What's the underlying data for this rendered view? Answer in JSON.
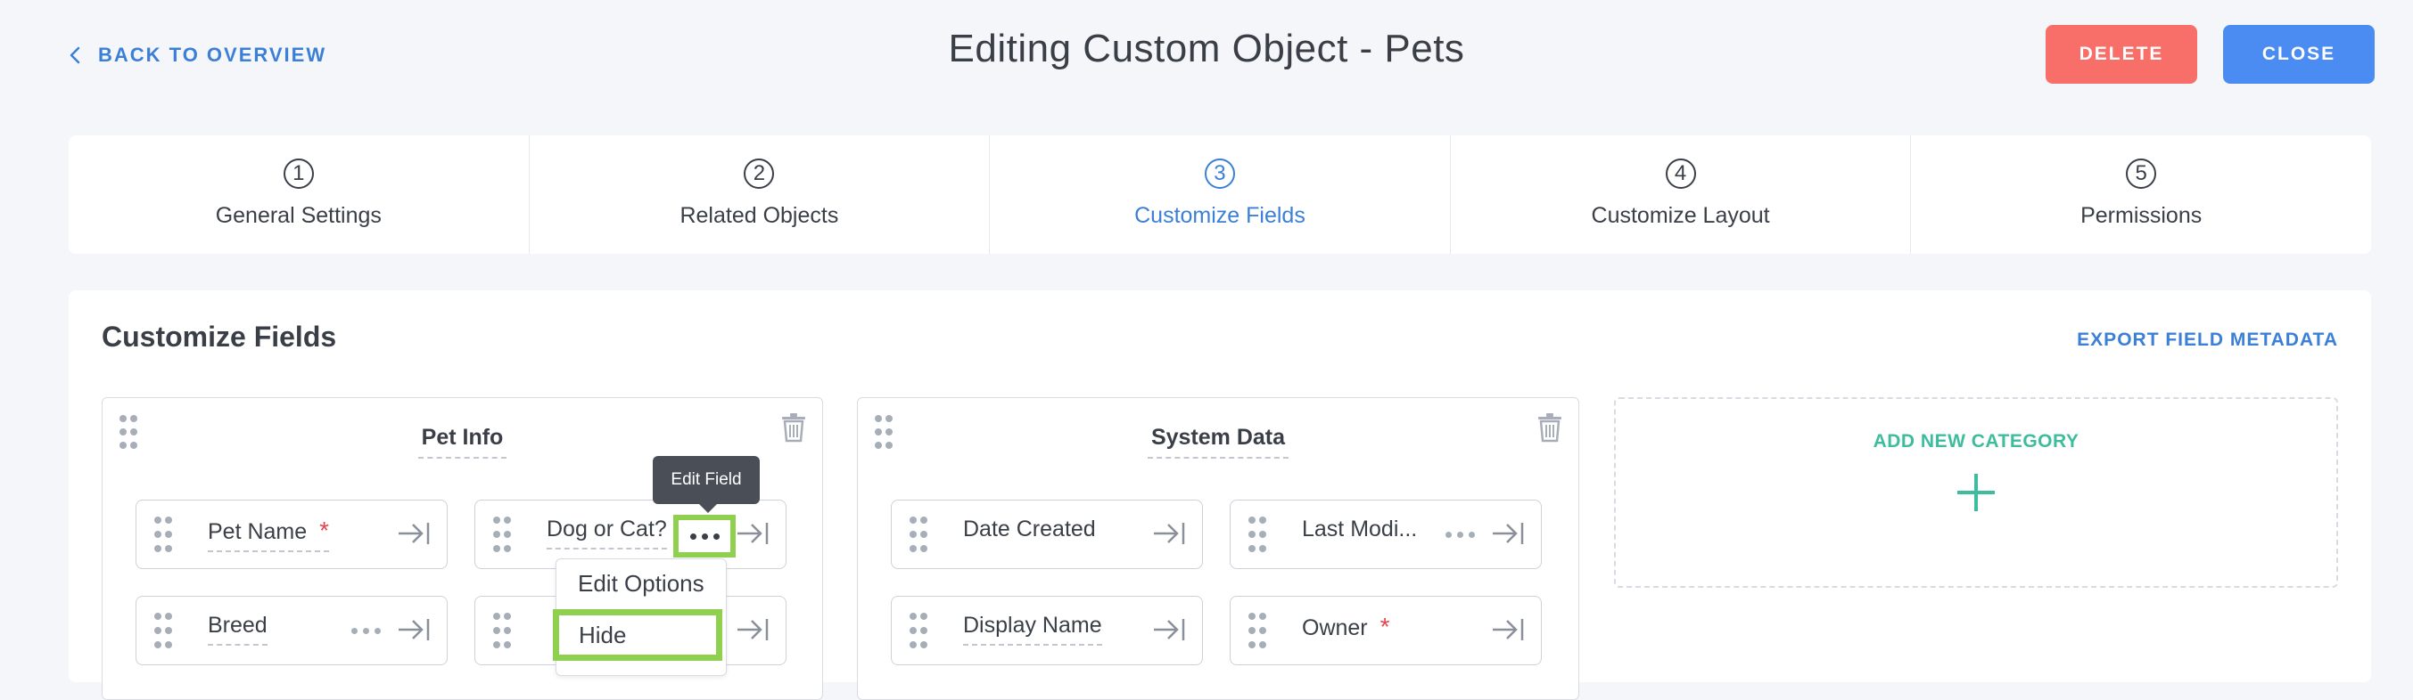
{
  "header": {
    "back_label": "BACK TO OVERVIEW",
    "title": "Editing Custom Object - Pets",
    "delete_label": "DELETE",
    "close_label": "CLOSE"
  },
  "steps": [
    {
      "num": "1",
      "label": "General Settings"
    },
    {
      "num": "2",
      "label": "Related Objects"
    },
    {
      "num": "3",
      "label": "Customize Fields",
      "active": true
    },
    {
      "num": "4",
      "label": "Customize Layout"
    },
    {
      "num": "5",
      "label": "Permissions"
    }
  ],
  "panel": {
    "title": "Customize Fields",
    "export_label": "EXPORT FIELD METADATA"
  },
  "categories": {
    "pet_info": {
      "title": "Pet Info",
      "fields": [
        {
          "label": "Pet Name",
          "required": "*"
        },
        {
          "label": "Dog or Cat?"
        },
        {
          "label": "Breed"
        }
      ]
    },
    "system_data": {
      "title": "System Data",
      "fields": [
        {
          "label": "Date Created"
        },
        {
          "label": "Last Modi..."
        },
        {
          "label": "Display Name"
        },
        {
          "label": "Owner",
          "required": "*"
        }
      ]
    },
    "add_new_label": "ADD NEW CATEGORY"
  },
  "tooltip": {
    "label": "Edit Field"
  },
  "context_menu": {
    "edit_options": "Edit Options",
    "hide": "Hide"
  },
  "colors": {
    "accent": "#3b7fd6",
    "delete": "#f86f6a",
    "close": "#4b8cf2",
    "add_new": "#3dbd9d",
    "highlight": "#8fd14f",
    "required": "#e6454a"
  }
}
